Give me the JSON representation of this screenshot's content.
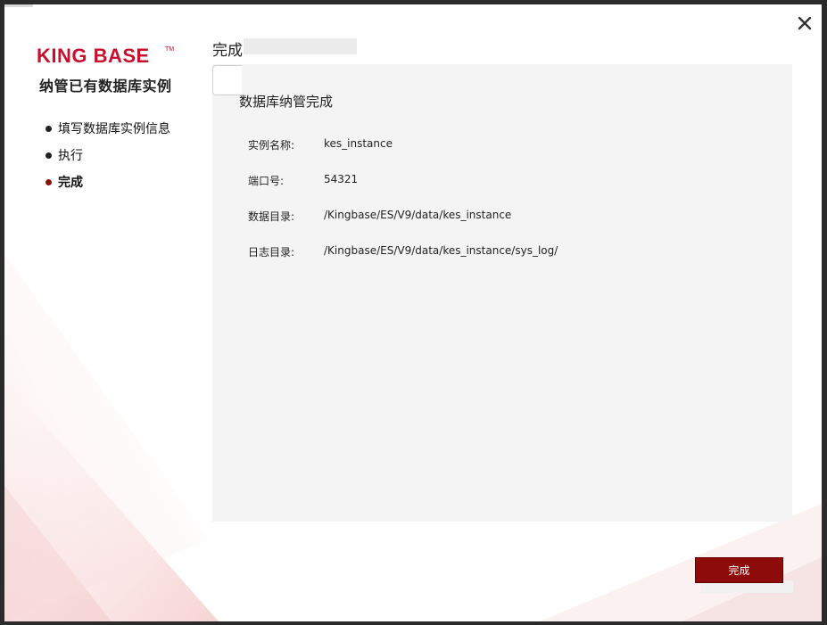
{
  "brand": {
    "logo_text": "KING BASE",
    "trademark": "TM",
    "app_title": "纳管已有数据库实例"
  },
  "colors": {
    "brand_red": "#c8102e",
    "accent_dark_red": "#8e0b0b",
    "panel_bg": "#f4f4f4"
  },
  "steps": [
    {
      "label": "填写数据库实例信息",
      "active": false
    },
    {
      "label": "执行",
      "active": false
    },
    {
      "label": "完成",
      "active": true
    }
  ],
  "page": {
    "heading": "完成"
  },
  "panel": {
    "title": "数据库纳管完成",
    "rows": [
      {
        "key": "实例名称:",
        "value": "kes_instance"
      },
      {
        "key": "端口号:",
        "value": "54321"
      },
      {
        "key": "数据目录:",
        "value": "/Kingbase/ES/V9/data/kes_instance"
      },
      {
        "key": "日志目录:",
        "value": "/Kingbase/ES/V9/data/kes_instance/sys_log/"
      }
    ]
  },
  "buttons": {
    "finish": "完成",
    "close_icon": "close-icon"
  }
}
